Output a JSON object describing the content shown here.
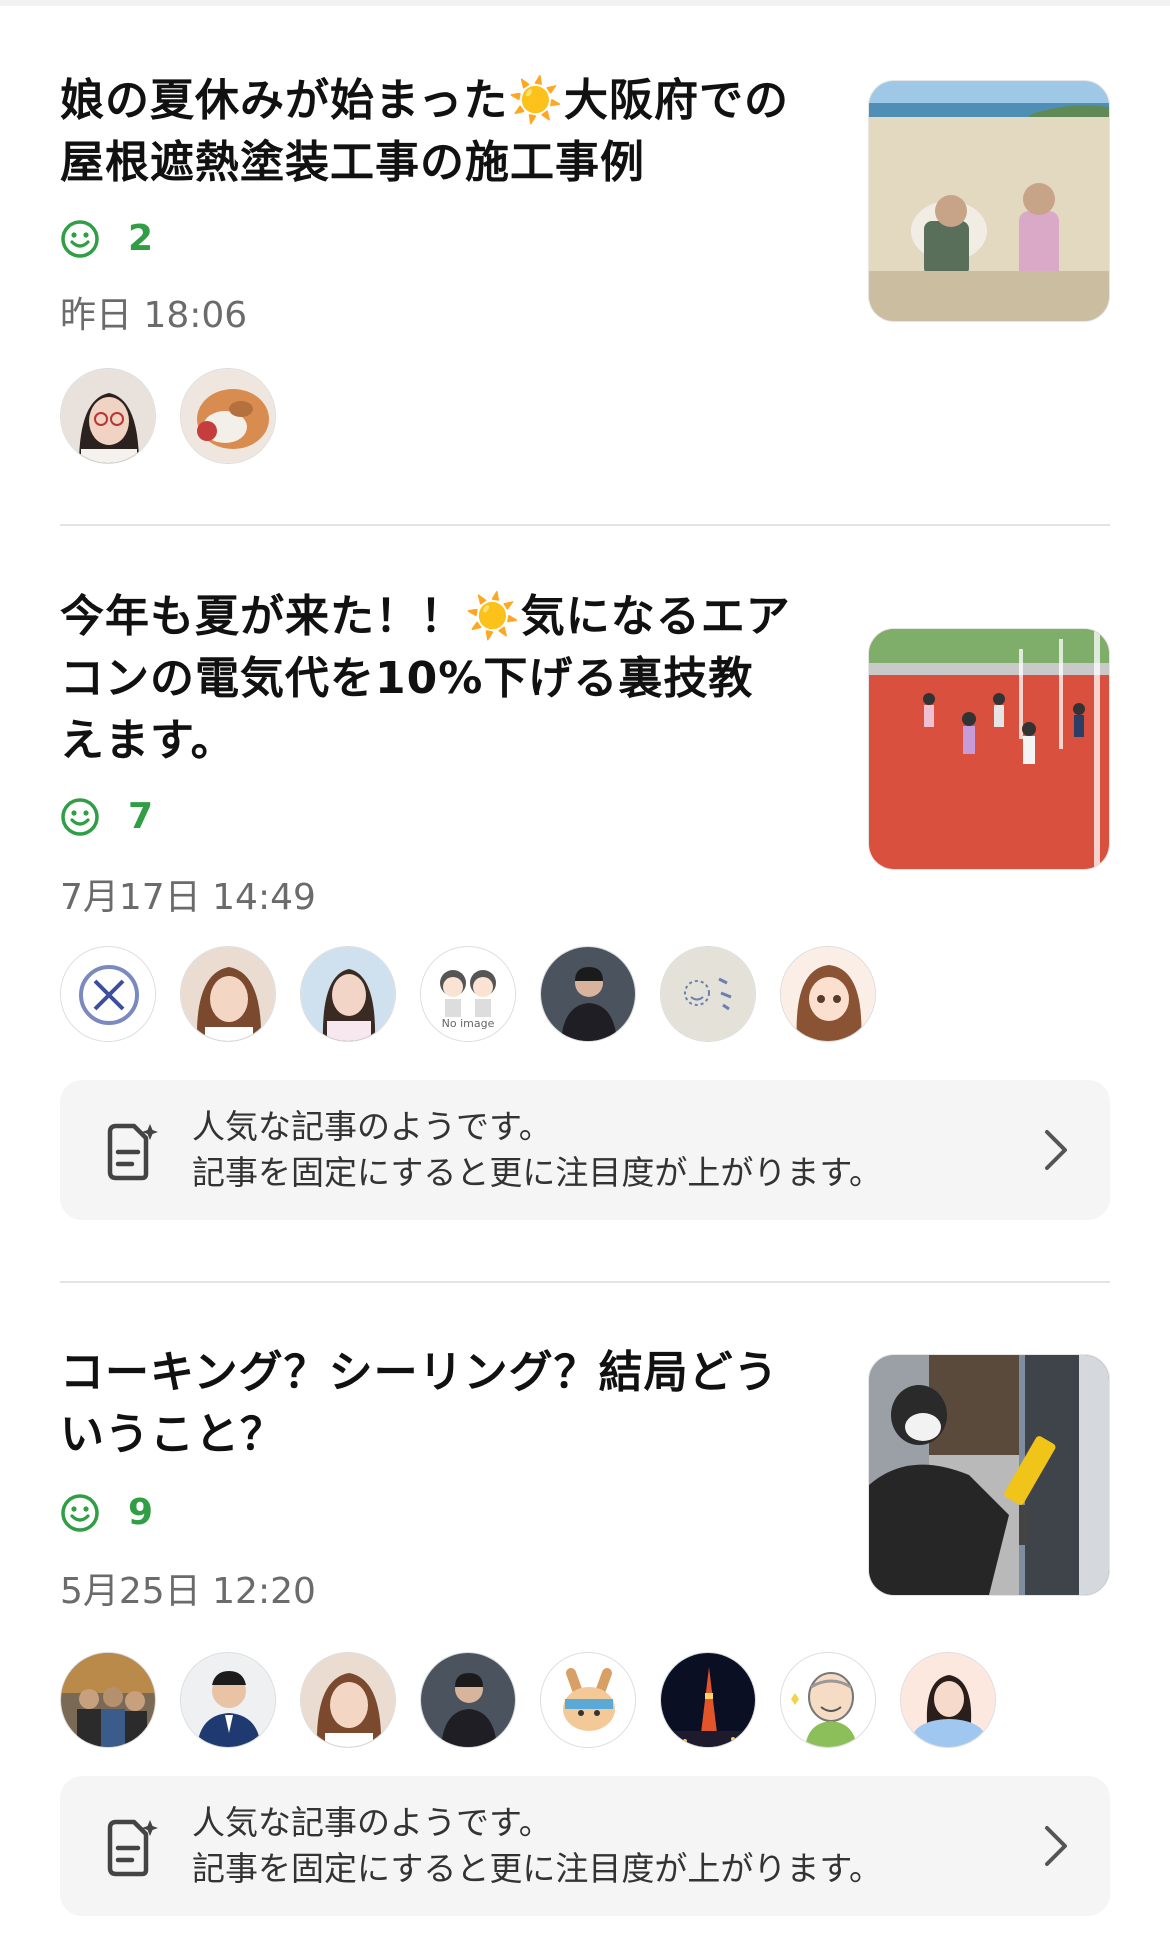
{
  "articles": [
    {
      "title_line1": "娘の夏休みが始まった☀️大阪府での",
      "title_line2": "屋根遮熱塗装工事の施工事例",
      "likes": "2",
      "date": "昨日 18:06"
    },
    {
      "title_line1": "今年も夏が来た！！☀️気になるエア",
      "title_line2": "コンの電気代を10%下げる裏技教",
      "title_line3": "えます。",
      "likes": "7",
      "date": "7月17日 14:49",
      "avatar_label": "No image"
    },
    {
      "title_line1": "コーキング？シーリング？結局どう",
      "title_line2": "いうこと？",
      "likes": "9",
      "date": "5月25日 12:20"
    }
  ],
  "promo": {
    "line1": "人気な記事のようです。",
    "line2": "記事を固定にすると更に注目度が上がります。"
  },
  "colors": {
    "like_green": "#2f9e44",
    "date_gray": "#6b6b6b",
    "promo_bg": "#f5f5f5"
  },
  "icons": [
    "smile-icon",
    "pin-article-icon",
    "chevron-right-icon"
  ]
}
